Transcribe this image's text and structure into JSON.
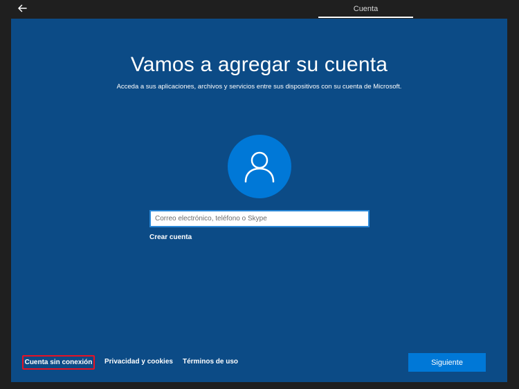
{
  "tab": {
    "label": "Cuenta"
  },
  "main": {
    "title": "Vamos a agregar su cuenta",
    "subtitle": "Acceda a sus aplicaciones, archivos y servicios entre sus dispositivos con su cuenta de Microsoft.",
    "avatar_icon": "user-icon",
    "email_input": {
      "value": "",
      "placeholder": "Correo electrónico, teléfono o Skype"
    },
    "create_account_label": "Crear cuenta"
  },
  "footer": {
    "offline_account_label": "Cuenta sin conexión",
    "privacy_label": "Privacidad y cookies",
    "terms_label": "Términos de uso",
    "next_label": "Siguiente"
  },
  "colors": {
    "panel_bg": "#0c4b86",
    "accent": "#0078d7",
    "highlight_border": "#e81123"
  }
}
